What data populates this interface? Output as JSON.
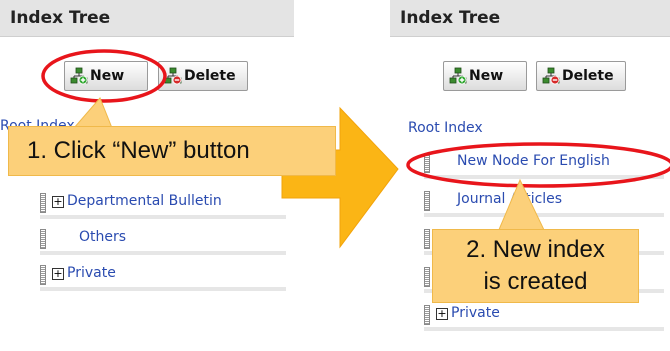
{
  "left_panel": {
    "title": "Index Tree",
    "new_label": "New",
    "delete_label": "Delete",
    "root_label": "Root Index",
    "items": [
      {
        "label": "Departmental Bulletin",
        "expandable": true
      },
      {
        "label": "Others",
        "expandable": false
      },
      {
        "label": "Private",
        "expandable": true
      }
    ]
  },
  "right_panel": {
    "title": "Index Tree",
    "new_label": "New",
    "delete_label": "Delete",
    "root_label": "Root Index",
    "items": [
      {
        "label": "New Node For English",
        "expandable": false
      },
      {
        "label": "Journal Articles",
        "expandable": false
      },
      {
        "label": "",
        "expandable": false
      },
      {
        "label": "",
        "expandable": false
      },
      {
        "label": "Private",
        "expandable": true
      }
    ]
  },
  "callouts": {
    "step1": "1. Click “New” button",
    "step2_line1": "2. New index",
    "step2_line2": "is created"
  },
  "colors": {
    "highlight_ring": "#e8151b",
    "callout_fill": "#fcd07a",
    "arrow_fill": "#fbb515",
    "link_text": "#2a4bb0"
  }
}
